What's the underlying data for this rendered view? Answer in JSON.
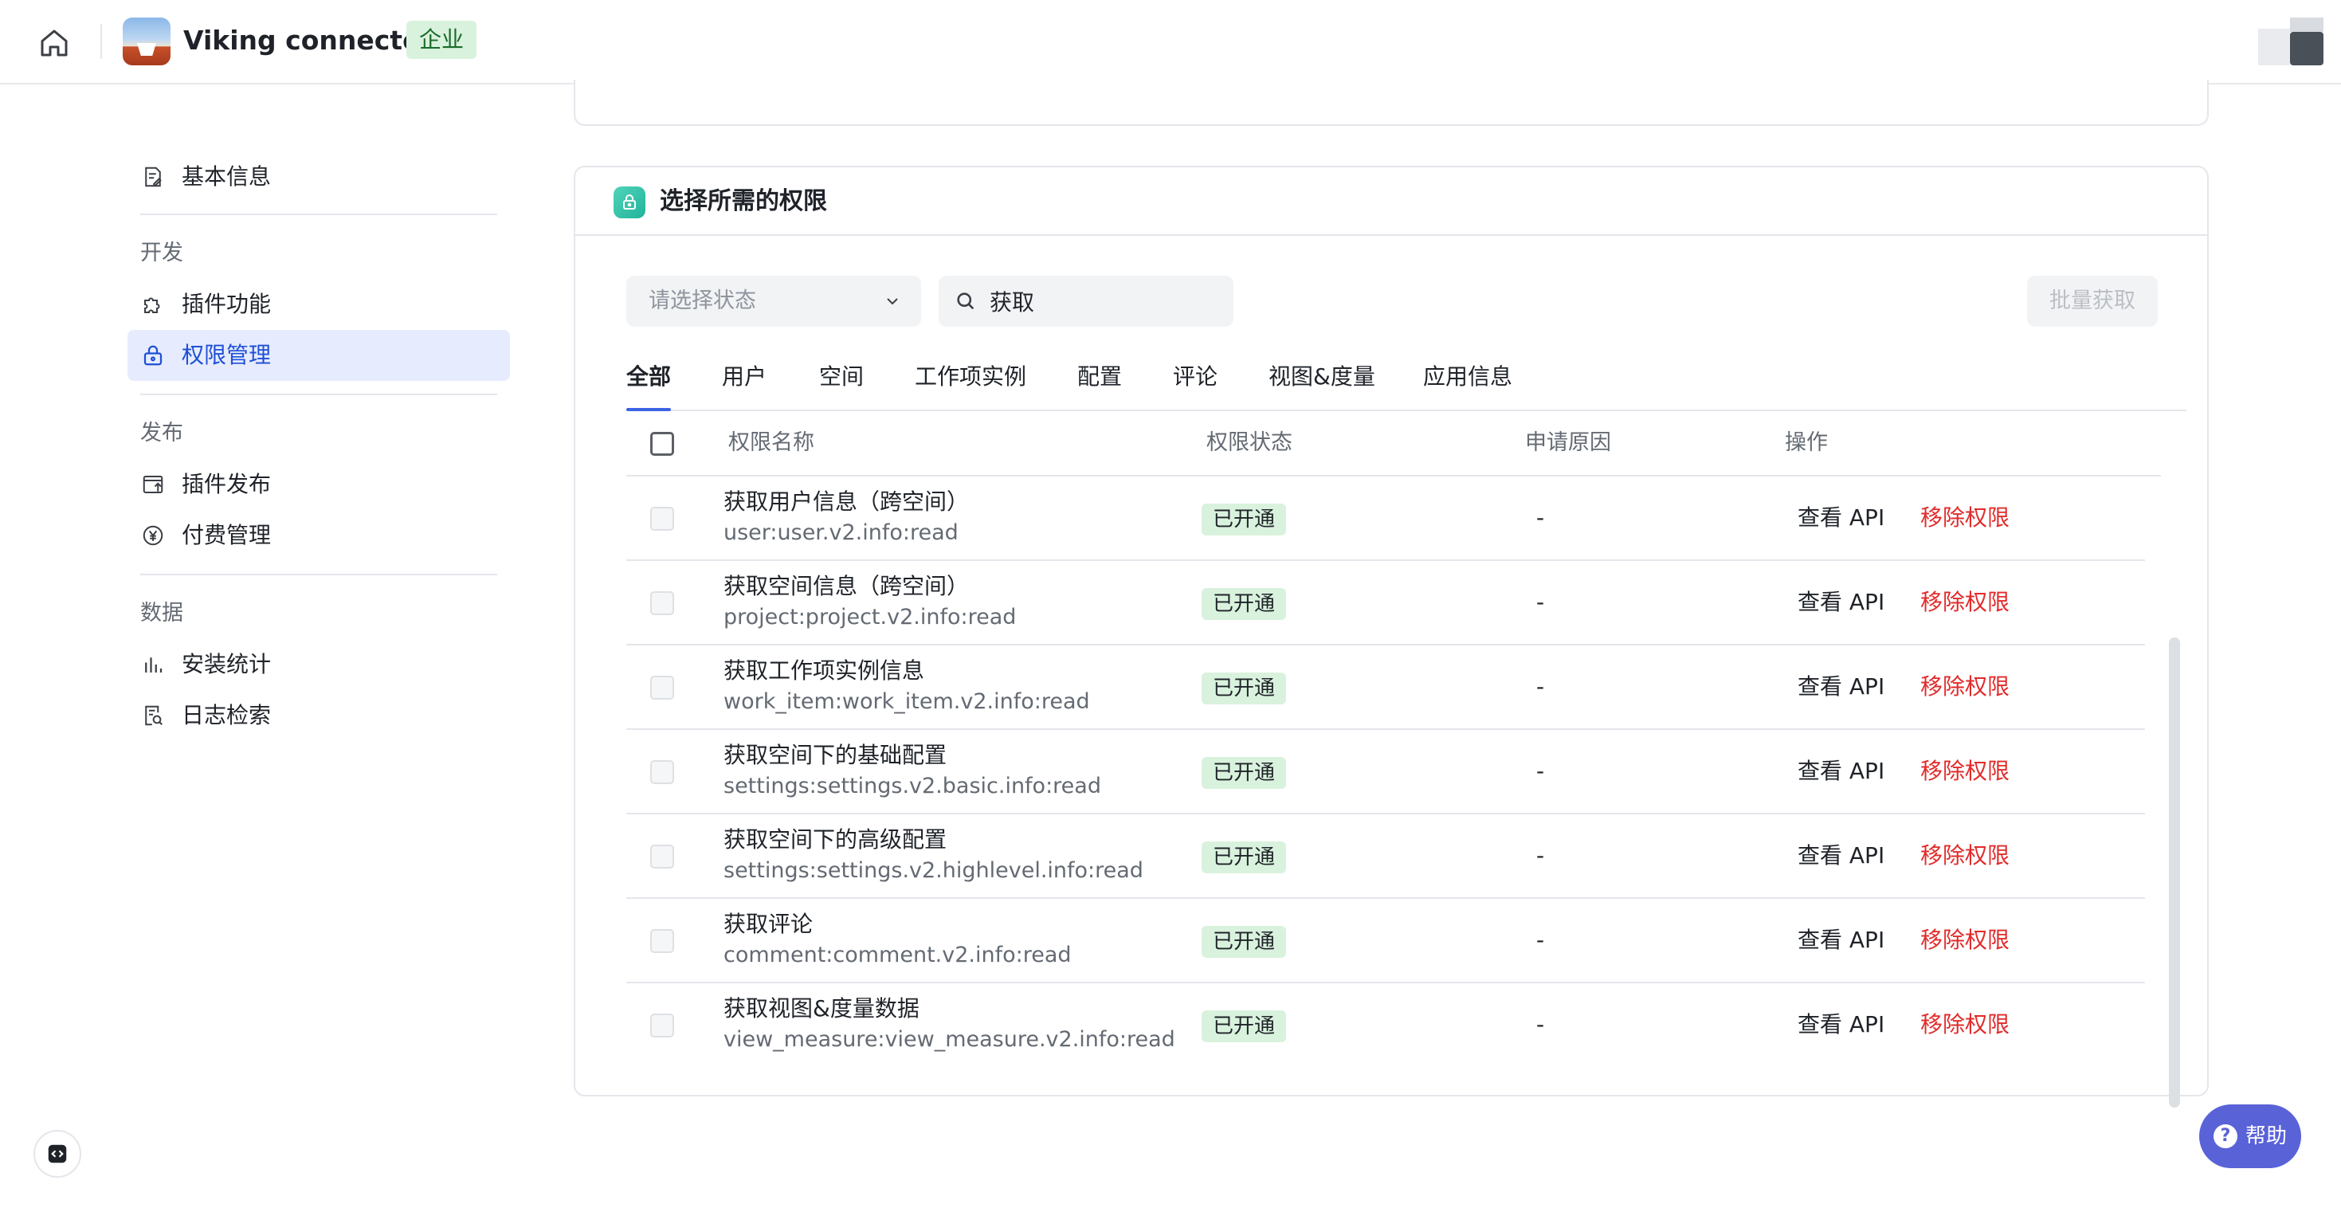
{
  "header": {
    "app_name": "Viking connector",
    "app_tag": "企业"
  },
  "sidebar": {
    "basic_info": "基本信息",
    "group_dev": "开发",
    "plugin_features": "插件功能",
    "permission_management": "权限管理",
    "group_publish": "发布",
    "plugin_publish": "插件发布",
    "paid_management": "付费管理",
    "group_data": "数据",
    "install_stats": "安装统计",
    "log_search": "日志检索"
  },
  "permissions_card": {
    "title": "选择所需的权限",
    "status_placeholder": "请选择状态",
    "search_value": "获取",
    "batch_button": "批量获取",
    "tabs": [
      "全部",
      "用户",
      "空间",
      "工作项实例",
      "配置",
      "评论",
      "视图&度量",
      "应用信息"
    ],
    "columns": {
      "name": "权限名称",
      "status": "权限状态",
      "reason": "申请原因",
      "action": "操作"
    },
    "rows": [
      {
        "name": "获取用户信息（跨空间）",
        "key": "user:user.v2.info:read",
        "status": "已开通",
        "reason": "-",
        "view": "查看 API",
        "remove": "移除权限"
      },
      {
        "name": "获取空间信息（跨空间）",
        "key": "project:project.v2.info:read",
        "status": "已开通",
        "reason": "-",
        "view": "查看 API",
        "remove": "移除权限"
      },
      {
        "name": "获取工作项实例信息",
        "key": "work_item:work_item.v2.info:read",
        "status": "已开通",
        "reason": "-",
        "view": "查看 API",
        "remove": "移除权限"
      },
      {
        "name": "获取空间下的基础配置",
        "key": "settings:settings.v2.basic.info:read",
        "status": "已开通",
        "reason": "-",
        "view": "查看 API",
        "remove": "移除权限"
      },
      {
        "name": "获取空间下的高级配置",
        "key": "settings:settings.v2.highlevel.info:read",
        "status": "已开通",
        "reason": "-",
        "view": "查看 API",
        "remove": "移除权限"
      },
      {
        "name": "获取评论",
        "key": "comment:comment.v2.info:read",
        "status": "已开通",
        "reason": "-",
        "view": "查看 API",
        "remove": "移除权限"
      },
      {
        "name": "获取视图&度量数据",
        "key": "view_measure:view_measure.v2.info:read",
        "status": "已开通",
        "reason": "-",
        "view": "查看 API",
        "remove": "移除权限"
      }
    ]
  },
  "floating": {
    "help_label": "帮助",
    "help_glyph": "?"
  },
  "colors": {
    "accent": "#3c63e6",
    "danger": "#e22b2b",
    "success_bg": "#d9f2dd",
    "help_bg": "#5a62d8"
  }
}
